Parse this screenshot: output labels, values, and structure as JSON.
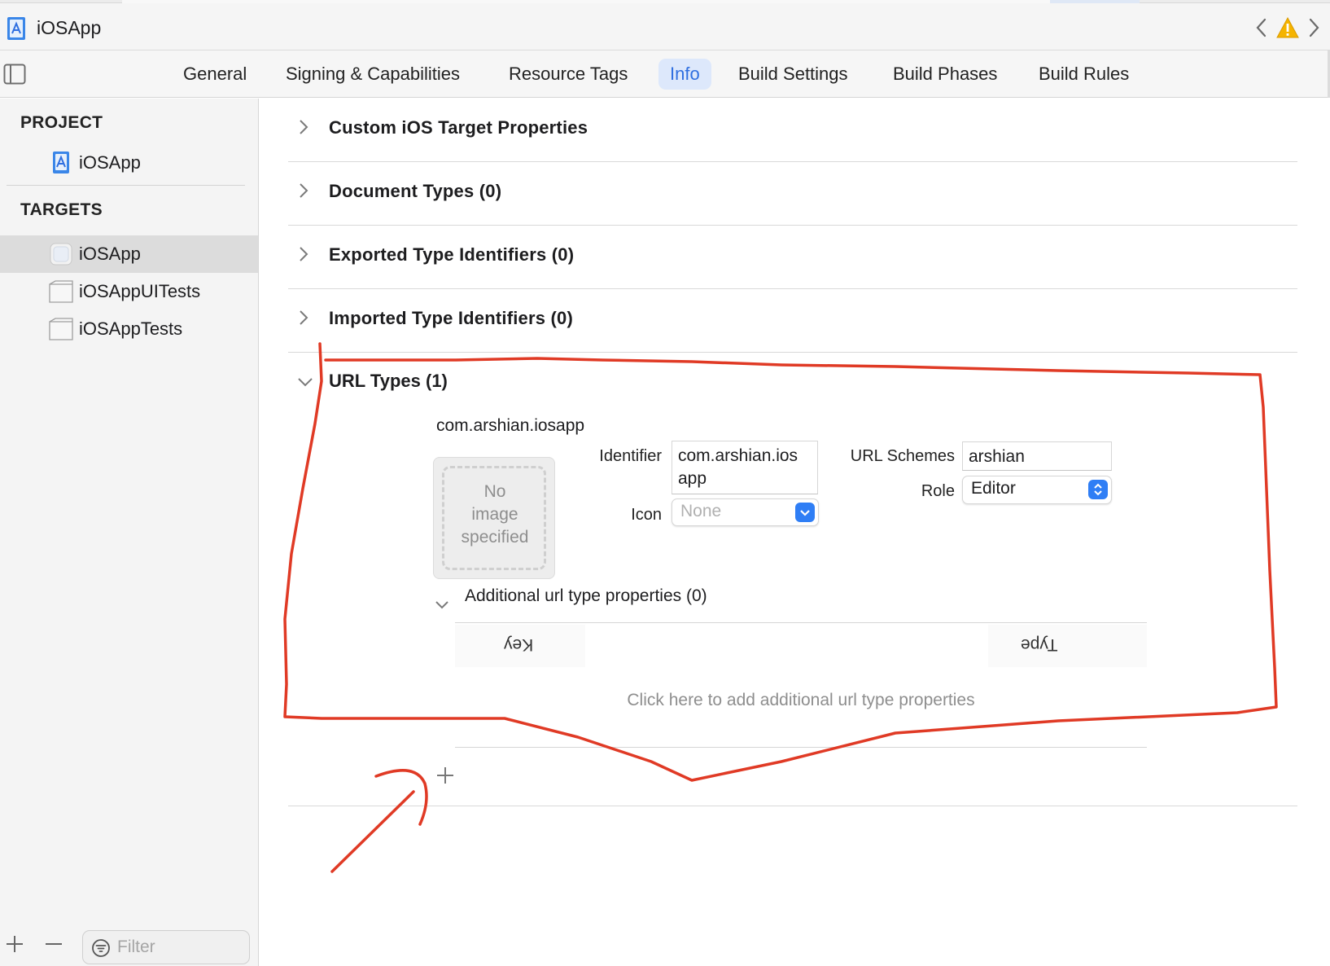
{
  "window": {
    "title": "iOSApp"
  },
  "tabs": [
    {
      "label": "General",
      "active": false
    },
    {
      "label": "Signing & Capabilities",
      "active": false
    },
    {
      "label": "Resource Tags",
      "active": false
    },
    {
      "label": "Info",
      "active": true
    },
    {
      "label": "Build Settings",
      "active": false
    },
    {
      "label": "Build Phases",
      "active": false
    },
    {
      "label": "Build Rules",
      "active": false
    }
  ],
  "sidebar": {
    "project_header": "PROJECT",
    "project_item": "iOSApp",
    "targets_header": "TARGETS",
    "targets": [
      {
        "label": "iOSApp",
        "selected": true
      },
      {
        "label": "iOSAppUITests",
        "selected": false
      },
      {
        "label": "iOSAppTests",
        "selected": false
      }
    ],
    "filter_placeholder": "Filter"
  },
  "sections": [
    {
      "title": "Custom iOS Target Properties",
      "expanded": false
    },
    {
      "title": "Document Types (0)",
      "expanded": false
    },
    {
      "title": "Exported Type Identifiers (0)",
      "expanded": false
    },
    {
      "title": "Imported Type Identifiers (0)",
      "expanded": false
    }
  ],
  "url_types": {
    "title": "URL Types (1)",
    "expanded": true,
    "entry_name": "com.arshian.iosapp",
    "image_placeholder": [
      "No",
      "image",
      "specified"
    ],
    "identifier_label": "Identifier",
    "identifier_value": [
      "com.arshian.ios",
      "app"
    ],
    "icon_label": "Icon",
    "icon_value": "None",
    "url_schemes_label": "URL Schemes",
    "url_schemes_value": "arshian",
    "role_label": "Role",
    "role_value": "Editor",
    "additional_title": "Additional url type properties (0)",
    "col_key": "Key",
    "col_type": "Type",
    "add_hint": "Click here to add additional url type properties"
  },
  "colors": {
    "accent": "#2f7ef5",
    "active_tab_bg": "#dde8fb",
    "active_tab_text": "#2f6fe0",
    "annotation_red": "#e03a25",
    "warning": "#f5b400"
  },
  "icons": {
    "app": "app-icon",
    "back": "chevron-left-icon",
    "warning": "warning-triangle-icon",
    "forward": "chevron-right-icon",
    "sidebar_toggle": "sidebar-toggle-icon",
    "add": "plus-icon",
    "remove": "minus-icon",
    "filter": "filter-icon"
  }
}
